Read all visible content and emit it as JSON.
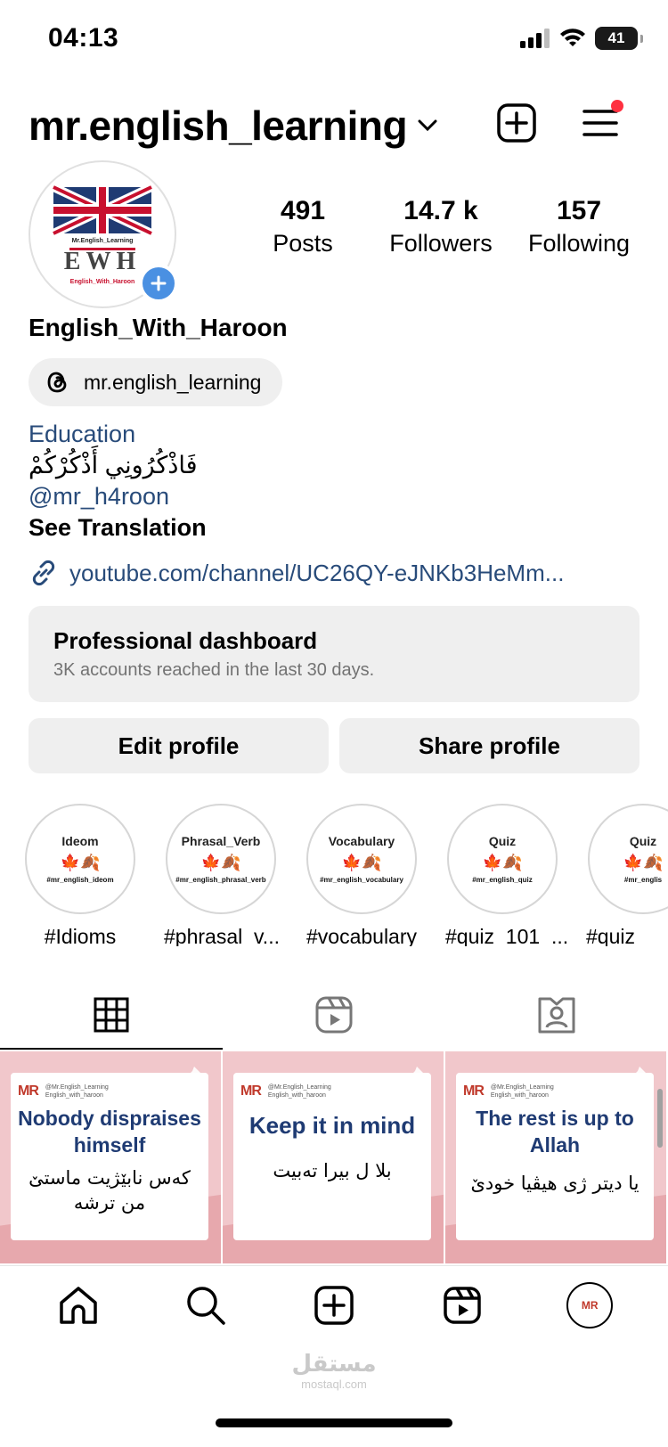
{
  "status_bar": {
    "time": "04:13",
    "battery": "41"
  },
  "header": {
    "username": "mr.english_learning"
  },
  "profile": {
    "avatar_text": {
      "line1": "MR",
      "line2": "Mr.English_Learning",
      "line3": "EWH",
      "line4": "English_With_Haroon"
    },
    "stats": [
      {
        "value": "491",
        "label": "Posts"
      },
      {
        "value": "14.7 k",
        "label": "Followers"
      },
      {
        "value": "157",
        "label": "Following"
      }
    ],
    "display_name": "English_With_Haroon",
    "threads_handle": "mr.english_learning",
    "category": "Education",
    "bio_line": "فَاذْكُرُونِي أَذْكُرْكُمْ",
    "mention": "@mr_h4roon",
    "see_translation": "See Translation",
    "external_link": "youtube.com/channel/UC26QY-eJNKb3HeMm..."
  },
  "dashboard": {
    "title": "Professional dashboard",
    "subtitle": "3K accounts reached in the last 30 days."
  },
  "buttons": {
    "edit": "Edit profile",
    "share": "Share profile"
  },
  "highlights": [
    {
      "title": "Ideom",
      "tag": "#mr_english_ideom",
      "label": "#Idioms"
    },
    {
      "title": "Phrasal_Verb",
      "tag": "#mr_english_phrasal_verb",
      "label": "#phrasal_v..."
    },
    {
      "title": "Vocabulary",
      "tag": "#mr_english_vocabulary",
      "label": "#vocabulary"
    },
    {
      "title": "Quiz",
      "tag": "#mr_english_quiz",
      "label": "#quiz_101_..."
    },
    {
      "title": "Quiz",
      "tag": "#mr_englis",
      "label": "#quiz_"
    }
  ],
  "posts": [
    {
      "brand": "MR",
      "handle1": "@Mr.English_Learning",
      "handle2": "English_with_haroon",
      "english": "Nobody dispraises himself",
      "kurdish": "کەس نابێژیت ماستێ من ترشە"
    },
    {
      "brand": "MR",
      "handle1": "@Mr.English_Learning",
      "handle2": "English_with_haroon",
      "english": "Keep it in mind",
      "kurdish": "بلا ل بیرا تەبیت"
    },
    {
      "brand": "MR",
      "handle1": "@Mr.English_Learning",
      "handle2": "English_with_haroon",
      "english": "The rest is up to Allah",
      "kurdish": "یا دیتر ژی هیڤیا خودێ"
    }
  ],
  "nav": {
    "avatar_text": "MR"
  },
  "watermark": {
    "arabic": "مستقل",
    "latin": "mostaql.com"
  },
  "colors": {
    "link": "#284b7a",
    "notif": "#ff3040",
    "add_badge": "#4a90e2",
    "post_bg": "#f1c7cb",
    "post_text": "#1f3b73"
  }
}
